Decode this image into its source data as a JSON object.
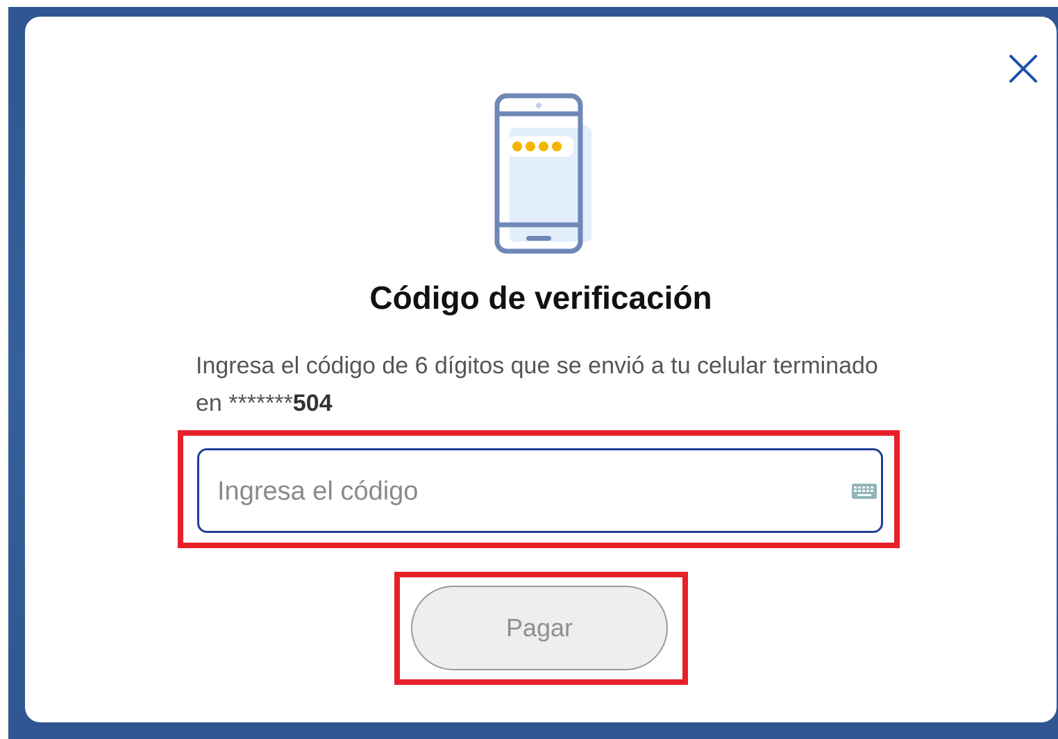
{
  "modal": {
    "title": "Código de verificación",
    "message": {
      "text": "Ingresa el código de 6 dígitos que se envió a tu celular terminado en *******",
      "phone_suffix": "504"
    },
    "close_icon": "close-icon",
    "illustration_icon": "phone-otp-icon"
  },
  "code_input": {
    "placeholder": "Ingresa el código",
    "value": "",
    "icon": "keyboard-icon"
  },
  "pay_button": {
    "label": "Pagar",
    "state": "disabled"
  },
  "colors": {
    "backdrop": "#2f5690",
    "input_border": "#1f3f9a",
    "highlight": "#e8202a",
    "dots": "#f5b400",
    "illustration_stroke": "#6f88b8",
    "illustration_fill": "#e3eefb"
  }
}
